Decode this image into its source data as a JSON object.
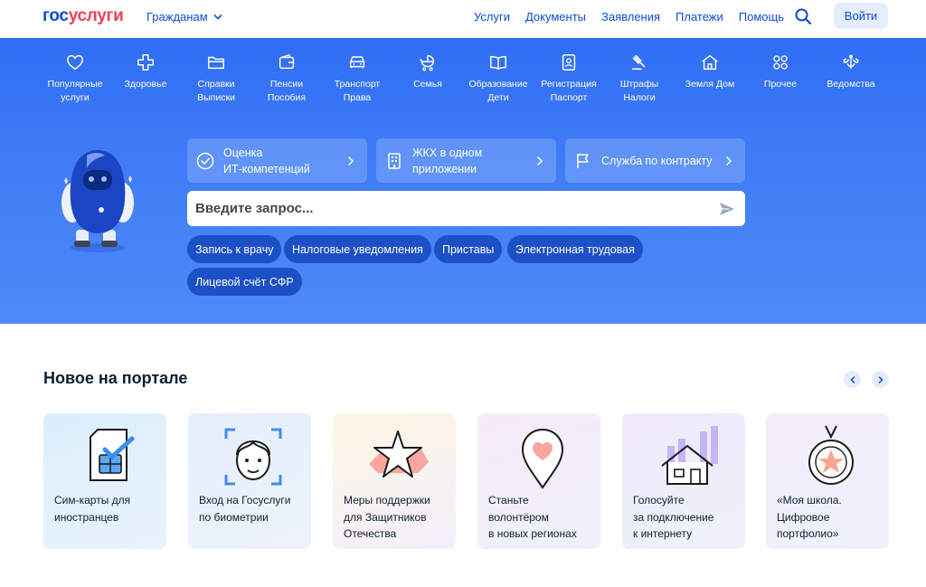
{
  "header": {
    "logo_part1": "гос",
    "logo_part2": "услуги",
    "audience": "Гражданам",
    "nav": [
      "Услуги",
      "Документы",
      "Заявления",
      "Платежи",
      "Помощь"
    ],
    "login": "Войти"
  },
  "categories": [
    {
      "line1": "Популярные",
      "line2": "услуги",
      "icon": "heart-icon"
    },
    {
      "line1": "Здоровье",
      "line2": "",
      "icon": "medical-cross-icon"
    },
    {
      "line1": "Справки",
      "line2": "Выписки",
      "icon": "folder-icon"
    },
    {
      "line1": "Пенсии",
      "line2": "Пособия",
      "icon": "wallet-icon"
    },
    {
      "line1": "Транспорт",
      "line2": "Права",
      "icon": "car-icon"
    },
    {
      "line1": "Семья",
      "line2": "",
      "icon": "stroller-icon"
    },
    {
      "line1": "Образование",
      "line2": "Дети",
      "icon": "book-icon"
    },
    {
      "line1": "Регистрация",
      "line2": "Паспорт",
      "icon": "passport-icon"
    },
    {
      "line1": "Штрафы",
      "line2": "Налоги",
      "icon": "gavel-icon"
    },
    {
      "line1": "Земля Дом",
      "line2": "",
      "icon": "house-icon"
    },
    {
      "line1": "Прочее",
      "line2": "",
      "icon": "grid-icon"
    },
    {
      "line1": "Ведомства",
      "line2": "",
      "icon": "emblem-icon"
    }
  ],
  "promos": [
    {
      "line1": "Оценка",
      "line2": "ИТ-компетенций"
    },
    {
      "line1": "ЖКХ в одном",
      "line2": "приложении"
    },
    {
      "line1": "Служба по контракту",
      "line2": ""
    }
  ],
  "search": {
    "placeholder": "Введите запрос..."
  },
  "chips": [
    "Запись к врачу",
    "Налоговые уведомления",
    "Приставы",
    "Электронная трудовая",
    "Лицевой счёт СФР"
  ],
  "news": {
    "title": "Новое на портале",
    "cards": [
      {
        "l1": "Сим-карты для",
        "l2": "иностранцев",
        "l3": ""
      },
      {
        "l1": "Вход на Госуслуги",
        "l2": "по биометрии",
        "l3": ""
      },
      {
        "l1": "Меры поддержки",
        "l2": "для Защитников",
        "l3": "Отечества"
      },
      {
        "l1": "Станьте",
        "l2": "волонтёром",
        "l3": "в новых регионах"
      },
      {
        "l1": "Голосуйте",
        "l2": "за подключение",
        "l3": "к интернету"
      },
      {
        "l1": "«Моя школа.",
        "l2": "Цифровое",
        "l3": "портфолио»"
      }
    ]
  },
  "colors": {
    "brand_blue": "#0d4cd3",
    "brand_red": "#ee3f58",
    "hero_blue": "#3e7cf6",
    "chip_blue": "#1d4fc7"
  }
}
